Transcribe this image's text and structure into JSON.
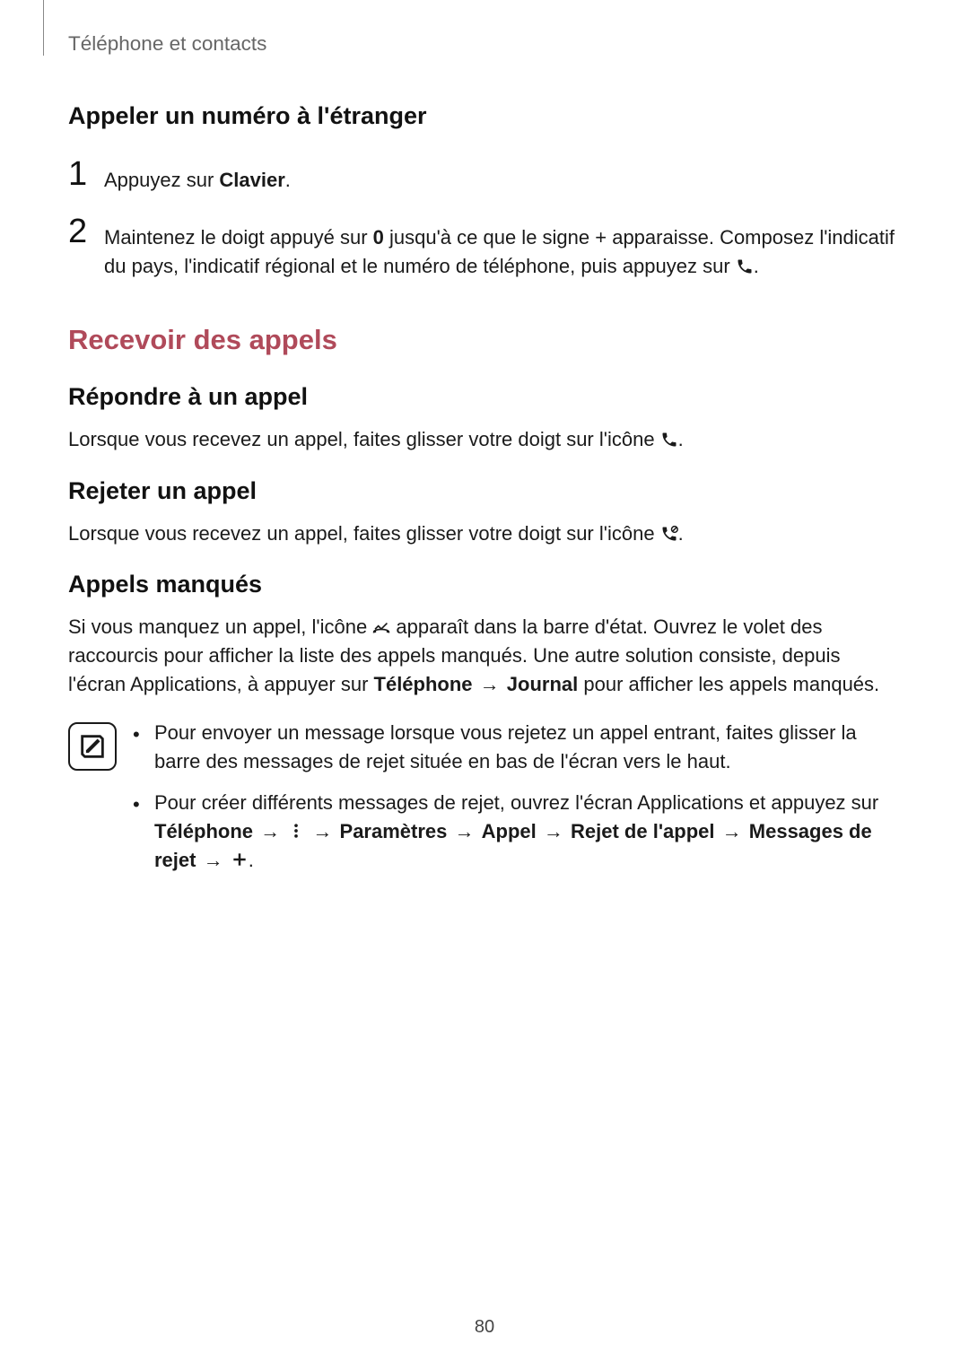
{
  "header": {
    "breadcrumb": "Téléphone et contacts"
  },
  "section1": {
    "heading": "Appeler un numéro à l'étranger",
    "steps": [
      {
        "num": "1",
        "text_pre": "Appuyez sur ",
        "bold": "Clavier",
        "text_post": "."
      },
      {
        "num": "2",
        "text_pre": "Maintenez le doigt appuyé sur ",
        "bold": "0",
        "text_mid": " jusqu'à ce que le signe + apparaisse. Composez l'indicatif du pays, l'indicatif régional et le numéro de téléphone, puis appuyez sur ",
        "text_post": "."
      }
    ]
  },
  "section2": {
    "heading": "Recevoir des appels",
    "sub1": {
      "heading": "Répondre à un appel",
      "text_pre": "Lorsque vous recevez un appel, faites glisser votre doigt sur l'icône ",
      "text_post": "."
    },
    "sub2": {
      "heading": "Rejeter un appel",
      "text_pre": "Lorsque vous recevez un appel, faites glisser votre doigt sur l'icône ",
      "text_post": "."
    },
    "sub3": {
      "heading": "Appels manqués",
      "text_p1_pre": "Si vous manquez un appel, l'icône ",
      "text_p1_mid": " apparaît dans la barre d'état. Ouvrez le volet des raccourcis pour afficher la liste des appels manqués. Une autre solution consiste, depuis l'écran Applications, à appuyer sur ",
      "bold1": "Téléphone",
      "arrow1": "→",
      "bold2": "Journal",
      "text_p1_post": " pour afficher les appels manqués."
    },
    "note": {
      "bullets": [
        {
          "text": "Pour envoyer un message lorsque vous rejetez un appel entrant, faites glisser la barre des messages de rejet située en bas de l'écran vers le haut."
        },
        {
          "text_pre": "Pour créer différents messages de rejet, ouvrez l'écran Applications et appuyez sur ",
          "path_telephone": "Téléphone",
          "arrow": "→",
          "path_parametres": "Paramètres",
          "path_appel": "Appel",
          "path_rejet": "Rejet de l'appel",
          "path_messages": "Messages de rejet",
          "text_post": "."
        }
      ]
    }
  },
  "page_number": "80",
  "icons": {
    "phone": "phone-icon",
    "phone_answer": "phone-answer-icon",
    "phone_reject": "phone-reject-icon",
    "missed_call": "missed-call-icon",
    "more_vert": "more-options-icon",
    "plus": "plus-icon",
    "note": "note-icon"
  }
}
